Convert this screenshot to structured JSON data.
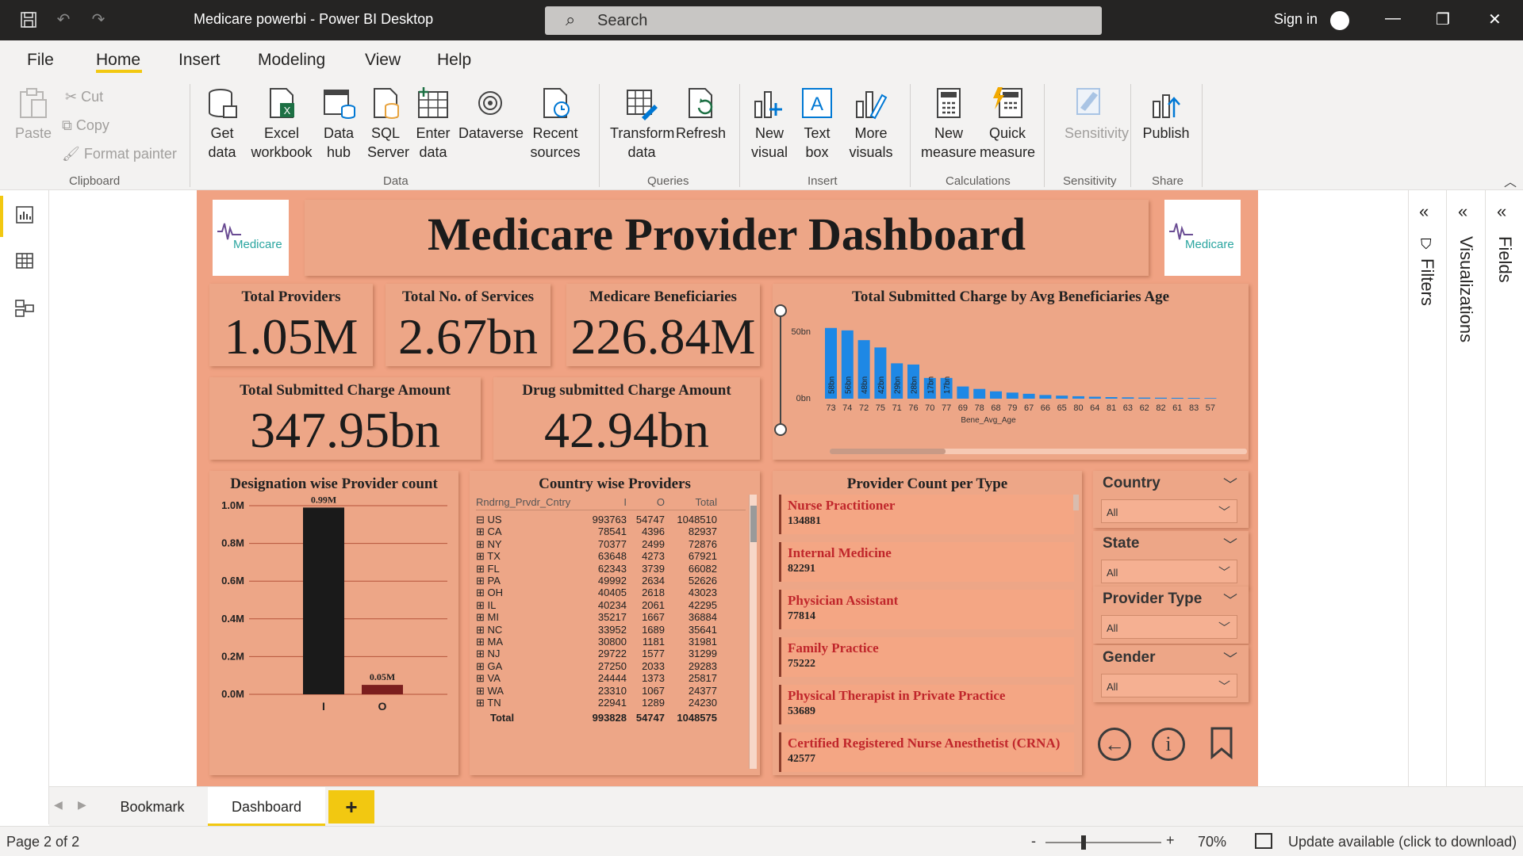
{
  "titlebar": {
    "title": "Medicare powerbi - Power BI Desktop",
    "search_placeholder": "Search",
    "sign_in": "Sign in"
  },
  "menu": [
    "File",
    "Home",
    "Insert",
    "Modeling",
    "View",
    "Help"
  ],
  "ribbon": {
    "clipboard": {
      "paste": "Paste",
      "cut": "Cut",
      "copy": "Copy",
      "format_painter": "Format painter",
      "label": "Clipboard"
    },
    "data": {
      "get_data": "Get data",
      "excel": "Excel workbook",
      "data_hub": "Data hub",
      "sql": "SQL Server",
      "enter": "Enter data",
      "dataverse": "Dataverse",
      "recent": "Recent sources",
      "label": "Data"
    },
    "queries": {
      "transform": "Transform data",
      "refresh": "Refresh",
      "label": "Queries"
    },
    "insert": {
      "new_visual": "New visual",
      "text_box": "Text box",
      "more_visuals": "More visuals",
      "label": "Insert"
    },
    "calculations": {
      "new_measure": "New measure",
      "quick_measure": "Quick measure",
      "label": "Calculations"
    },
    "sensitivity": {
      "sensitivity": "Sensitivity",
      "label": "Sensitivity"
    },
    "share": {
      "publish": "Publish",
      "label": "Share"
    }
  },
  "dashboard": {
    "title": "Medicare Provider Dashboard",
    "logo_text": "Medicare",
    "kpis": [
      {
        "label": "Total Providers",
        "value": "1.05M"
      },
      {
        "label": "Total No. of Services",
        "value": "2.67bn"
      },
      {
        "label": "Medicare Beneficiaries",
        "value": "226.84M"
      },
      {
        "label": "Total Submitted Charge Amount",
        "value": "347.95bn"
      },
      {
        "label": "Drug submitted Charge Amount",
        "value": "42.94bn"
      }
    ],
    "age_chart_title": "Total Submitted Charge by Avg Beneficiaries Age",
    "designation_title": "Designation wise Provider count",
    "country_title": "Country wise Providers",
    "ptype_title": "Provider Count per Type"
  },
  "chart_data": [
    {
      "type": "bar",
      "title": "Total Submitted Charge by Avg Beneficiaries Age",
      "xlabel": "Bene_Avg_Age",
      "ylabel": "",
      "yticks": [
        "50bn",
        "0bn"
      ],
      "ylim": [
        0,
        65
      ],
      "categories": [
        "73",
        "74",
        "72",
        "75",
        "71",
        "76",
        "70",
        "77",
        "69",
        "78",
        "68",
        "79",
        "67",
        "66",
        "65",
        "80",
        "64",
        "81",
        "63",
        "62",
        "82",
        "61",
        "83",
        "57"
      ],
      "values": [
        58,
        56,
        48,
        42,
        29,
        28,
        17,
        17,
        10,
        8,
        6,
        5,
        4,
        3,
        2.5,
        2,
        1.6,
        1.3,
        1.1,
        0.9,
        0.8,
        0.7,
        0.6,
        0.5
      ],
      "data_labels": [
        "58bn",
        "56bn",
        "48bn",
        "42bn",
        "29bn",
        "28bn",
        "17bn",
        "17bn"
      ],
      "color": "#1e88e5"
    },
    {
      "type": "bar",
      "title": "Designation wise Provider count",
      "categories": [
        "I",
        "O"
      ],
      "values": [
        0.99,
        0.05
      ],
      "data_labels": [
        "0.99M",
        "0.05M"
      ],
      "yticks": [
        "1.0M",
        "0.8M",
        "0.6M",
        "0.4M",
        "0.2M",
        "0.0M"
      ],
      "ylim": [
        0,
        1.0
      ],
      "colors": [
        "#1a1a1a",
        "#7b1e1e"
      ]
    },
    {
      "type": "table",
      "title": "Country wise Providers",
      "columns": [
        "Rndrng_Prvdr_Cntry",
        "I",
        "O",
        "Total"
      ],
      "rows": [
        [
          "US",
          "993763",
          "54747",
          "1048510"
        ],
        [
          "CA",
          "78541",
          "4396",
          "82937"
        ],
        [
          "NY",
          "70377",
          "2499",
          "72876"
        ],
        [
          "TX",
          "63648",
          "4273",
          "67921"
        ],
        [
          "FL",
          "62343",
          "3739",
          "66082"
        ],
        [
          "PA",
          "49992",
          "2634",
          "52626"
        ],
        [
          "OH",
          "40405",
          "2618",
          "43023"
        ],
        [
          "IL",
          "40234",
          "2061",
          "42295"
        ],
        [
          "MI",
          "35217",
          "1667",
          "36884"
        ],
        [
          "NC",
          "33952",
          "1689",
          "35641"
        ],
        [
          "MA",
          "30800",
          "1181",
          "31981"
        ],
        [
          "NJ",
          "29722",
          "1577",
          "31299"
        ],
        [
          "GA",
          "27250",
          "2033",
          "29283"
        ],
        [
          "VA",
          "24444",
          "1373",
          "25817"
        ],
        [
          "WA",
          "23310",
          "1067",
          "24377"
        ],
        [
          "TN",
          "22941",
          "1289",
          "24230"
        ]
      ],
      "total": [
        "Total",
        "993828",
        "54747",
        "1048575"
      ]
    }
  ],
  "provider_types": [
    {
      "name": "Nurse Practitioner",
      "count": "134881"
    },
    {
      "name": "Internal Medicine",
      "count": "82291"
    },
    {
      "name": "Physician Assistant",
      "count": "77814"
    },
    {
      "name": "Family Practice",
      "count": "75222"
    },
    {
      "name": "Physical Therapist in Private Practice",
      "count": "53689"
    },
    {
      "name": "Certified Registered Nurse Anesthetist (CRNA)",
      "count": "42577"
    }
  ],
  "slicers": [
    {
      "label": "Country",
      "value": "All"
    },
    {
      "label": "State",
      "value": "All"
    },
    {
      "label": "Provider Type",
      "value": "All"
    },
    {
      "label": "Gender",
      "value": "All"
    }
  ],
  "panes": {
    "filters": "Filters",
    "visualizations": "Visualizations",
    "fields": "Fields"
  },
  "tabs": {
    "bookmark": "Bookmark",
    "dashboard": "Dashboard",
    "add": "+"
  },
  "status": {
    "page": "Page 2 of 2",
    "zoom": "70%",
    "update": "Update available (click to download)"
  }
}
